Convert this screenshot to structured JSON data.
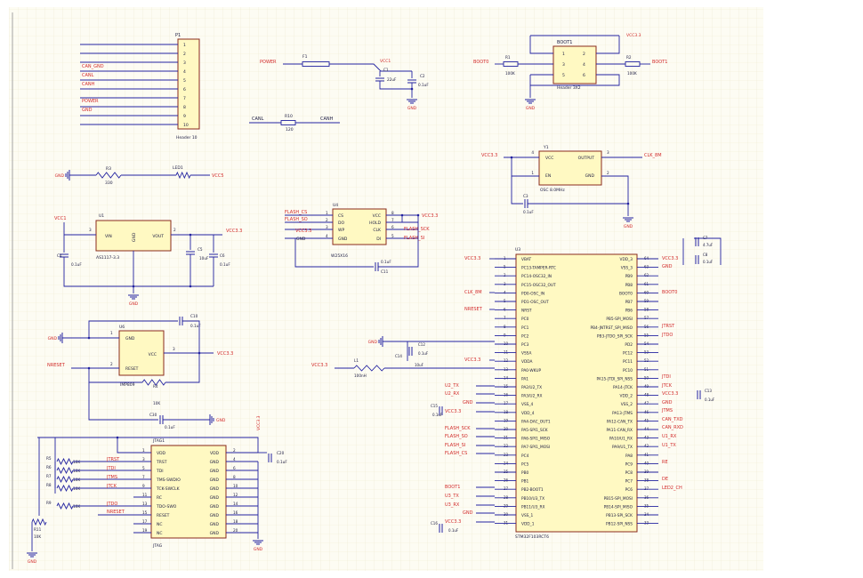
{
  "colors": {
    "sheet": "#fdfcf3",
    "grid": "#efe9d2",
    "wire": "#2222a0",
    "chip_fill": "#fff9c2",
    "chip_edge": "#8a2a1e",
    "net_red": "#d22a2a",
    "text": "#1a1a40",
    "ground": "#2222a0"
  },
  "p1": {
    "ref": "P1",
    "name": "Header 10",
    "pins": [
      "1",
      "2",
      "3",
      "4",
      "5",
      "6",
      "7",
      "8",
      "9",
      "10"
    ],
    "nets": [
      "CAN_GND",
      "CANL",
      "CANH",
      "POWER",
      "GND"
    ]
  },
  "power_in": {
    "net": "POWER",
    "fuse": "F1",
    "vcc": "VCC1",
    "c1": "C1",
    "c1_val": "22uF",
    "c2": "C2",
    "c2_val": "0.1uF",
    "gnd": "GND"
  },
  "canbus": {
    "left": "CANL",
    "right": "CANH",
    "ref": "R10",
    "val": "120"
  },
  "boot": {
    "ref": "BOOT1",
    "name": "Header 3X2",
    "pins": [
      "1",
      "2",
      "3",
      "4",
      "5",
      "6"
    ],
    "r1": "R1",
    "r1_val": "100K",
    "r2": "R2",
    "r2_val": "100K",
    "boot0": "BOOT0",
    "boot1": "BOOT1",
    "vcc": "VCC3.3",
    "gnd": "GND"
  },
  "led": {
    "gnd": "GND",
    "r": "R3",
    "r_val": "330",
    "led": "LED1",
    "vcc": "VCC5"
  },
  "osc": {
    "ref": "Y1",
    "name": "OSC 8.0MHz",
    "vcc": "VCC3.3",
    "pin_vcc": "VCC",
    "pin_out": "OUTPUT",
    "pin_en": "EN",
    "pin_gnd": "GND",
    "out_net": "CLK_8M",
    "cap": "C3",
    "cap_val": "0.1uF",
    "gnd": "GND",
    "pins": [
      "4",
      "1",
      "3",
      "2"
    ]
  },
  "ldo": {
    "ref": "U1",
    "name": "AS1117-3.3",
    "vin": "VIN",
    "vout": "VOUT",
    "gnd_pin": "GND",
    "vin_net": "VCC1",
    "vout_net": "VCC3.3",
    "c_in": "C4",
    "c_in_val": "0.1uF",
    "c_mid": "C5",
    "c_mid_val": "10uF",
    "c_out": "C6",
    "c_out_val": "0.1uF",
    "gnd": "GND",
    "pin_in": "3",
    "pin_out": "2"
  },
  "flash": {
    "ref": "U4",
    "name": "W25X16",
    "left_nets": [
      "FLASH_CS",
      "FLASH_SO",
      "VCC3.3",
      "GND"
    ],
    "left_pins": [
      "1",
      "2",
      "3",
      "4"
    ],
    "left_names": [
      "CS",
      "DO",
      "WP",
      "GND"
    ],
    "right_names": [
      "VCC",
      "HOLD",
      "CLK",
      "DI"
    ],
    "right_pins": [
      "8",
      "7",
      "6",
      "5"
    ],
    "right_nets": [
      "VCC3.3",
      "FLASH_SCK",
      "FLASH_SI"
    ],
    "cap": "C11",
    "cap_val": "0.1uF"
  },
  "reset": {
    "ref": "U6",
    "name": "IMP809",
    "gnd_pin": "GND",
    "vcc_pin": "VCC",
    "rst_pin": "RESET",
    "nreset": "NRESET",
    "vcc": "VCC3.3",
    "gnd": "GND",
    "c_top": "C10",
    "c_top_val": "0.1uF",
    "r": "R4",
    "r_val": "10K",
    "c_bot": "C30",
    "c_bot_val": "0.1uF",
    "pins": [
      "1",
      "2",
      "3"
    ]
  },
  "jtag": {
    "ref": "JTAG1",
    "name": "JTAG",
    "vcc": "VCC3.3",
    "gnd": "GND",
    "left_names": [
      "VDD",
      "TRST",
      "TDI",
      "TMS-SWDIO",
      "TCK-SWCLK",
      "RC",
      "TDO-SWO",
      "RESET",
      "NC",
      "NC"
    ],
    "right_names": [
      "VDD",
      "GND",
      "GND",
      "GND",
      "GND",
      "GND",
      "GND",
      "GND",
      "GND",
      "GND"
    ],
    "left_pins": [
      "1",
      "3",
      "5",
      "7",
      "9",
      "11",
      "13",
      "15",
      "17",
      "19"
    ],
    "right_pins": [
      "2",
      "4",
      "6",
      "8",
      "10",
      "12",
      "14",
      "16",
      "18",
      "20"
    ],
    "nets": [
      "JTRST",
      "JTDI",
      "JTMS",
      "JTCK",
      "JTDO",
      "NRESET"
    ],
    "resistors": [
      "R5",
      "R6",
      "R7",
      "R8",
      "R9"
    ],
    "r_vals": [
      "10K",
      "10K",
      "10K",
      "10K",
      "10K"
    ],
    "r_pull": "R11",
    "r_pull_val": "10K",
    "cap": "C20",
    "cap_val": "0.1uF"
  },
  "mcu": {
    "ref": "U3",
    "name": "STM32F103RCT6",
    "left_pins": [
      "1",
      "5",
      "2",
      "3",
      "4",
      "5",
      "6",
      "7",
      "8",
      "9",
      "10",
      "11",
      "12",
      "13",
      "14",
      "15",
      "16",
      "17",
      "18",
      "19",
      "20",
      "21",
      "22",
      "23",
      "24",
      "25",
      "26",
      "27",
      "28",
      "29",
      "30",
      "31",
      "32"
    ],
    "left_names": [
      "VBAT",
      "PC13-TAMPER-RTC",
      "PC14-OSC32_IN",
      "PC15-OSC32_OUT",
      "PD0-OSC_IN",
      "PD1-OSC_OUT",
      "NRST",
      "PC0",
      "PC1",
      "PC2",
      "PC3",
      "VSSA",
      "VDDA",
      "PA0-WKUP",
      "PA1",
      "PA2/U2_TX",
      "PA3/U2_RX",
      "VSS_4",
      "VDD_4",
      "PA4-DAC_OUT1",
      "PA5-SPI1_SCK",
      "PA6-SPI1_MISO",
      "PA7-SPI1_MOSI",
      "PC4",
      "PC5",
      "PB0",
      "PB1",
      "PB2-BOOT1",
      "PB10/U3_TX",
      "PB11/U3_RX",
      "VSS_1",
      "VDD_1"
    ],
    "right_pins": [
      "64",
      "63",
      "62",
      "61",
      "60",
      "59",
      "58",
      "57",
      "56",
      "55",
      "54",
      "53",
      "52",
      "51",
      "50",
      "49",
      "48",
      "47",
      "46",
      "45",
      "44",
      "43",
      "42",
      "41",
      "40",
      "39",
      "38",
      "37",
      "36",
      "35",
      "34",
      "33"
    ],
    "right_names": [
      "VDD_3",
      "VSS_3",
      "PB9",
      "PB8",
      "BOOT0",
      "PB7",
      "PB6",
      "PB5-SPI_MOSI",
      "PB4-JNTRST_SPI_MISO",
      "PB3-JTDO_SPI_SCK",
      "PD2",
      "PC12",
      "PC11",
      "PC10",
      "PA15-JTDI_SPI_NSS",
      "PA14-JTCK",
      "VDD_2",
      "VSS_2",
      "PA13-JTMS",
      "PA12-CAN_TX",
      "PA11-CAN_RX",
      "PA10/U1_RX",
      "PA9/U1_TX",
      "PA8",
      "PC9",
      "PC8",
      "PC7",
      "PC6",
      "PB15-SPI_MOSI",
      "PB14-SPI_MISO",
      "PB13-SPI_SCK",
      "PB12-SPI_NSS"
    ],
    "left_nets": [
      "VCC3.3",
      "CLK_8M",
      "NRESET",
      "VCC3.3",
      "U2_TX",
      "U2_RX",
      "GND",
      "VCC3.3",
      "FLASH_SCK",
      "FLASH_SO",
      "FLASH_SI",
      "FLASH_CS",
      "BOOT1",
      "U3_TX",
      "U3_RX",
      "GND",
      "VCC3.3"
    ],
    "right_nets": [
      "VCC3.3",
      "GND",
      "BOOT0",
      "JTRST",
      "JTDO",
      "JTDI",
      "JTCK",
      "VCC3.3",
      "GND",
      "JTMS",
      "CAN_TXD",
      "CAN_RXD",
      "U1_RX",
      "U1_TX",
      "RE",
      "DE",
      "LED2_CH"
    ],
    "caps": [
      "C7",
      "C8",
      "C9",
      "C12",
      "C13",
      "C14",
      "C15",
      "C16"
    ],
    "cap_vals": [
      "4.7uF",
      "0.1uF",
      "0.1uF",
      "0.1uF",
      "0.1uF",
      "10uF",
      "0.1uF",
      "0.1uF"
    ],
    "inductor": "L1",
    "inductor_val": "100nH"
  }
}
